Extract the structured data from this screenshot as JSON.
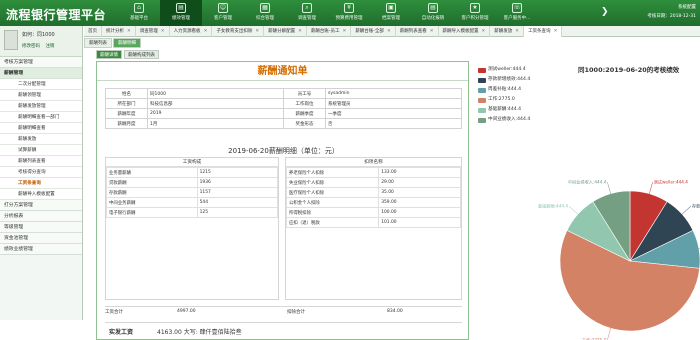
{
  "header": {
    "title": "流程银行管理平台",
    "right_line1": "系统配置",
    "right_line2": "考核日期：2018-12-31"
  },
  "modules": [
    {
      "label": "基础平台",
      "icon": "home-icon"
    },
    {
      "label": "绩效管理",
      "icon": "chart-icon"
    },
    {
      "label": "客户管理",
      "icon": "users-icon"
    },
    {
      "label": "综合管理",
      "icon": "grid-icon"
    },
    {
      "label": "调查管理",
      "icon": "search-icon"
    },
    {
      "label": "预算费用管理",
      "icon": "budget-icon"
    },
    {
      "label": "档案管理",
      "icon": "folder-icon"
    },
    {
      "label": "自动化报销",
      "icon": "document-icon"
    },
    {
      "label": "客户积分管理",
      "icon": "star-icon"
    },
    {
      "label": "客户服务中...",
      "icon": "service-icon"
    }
  ],
  "sidebar": {
    "user_name": "如何：同1000",
    "actions": [
      "修改密码",
      "注销"
    ],
    "groups": [
      {
        "label": "考核方案管理",
        "open": false
      },
      {
        "label": "薪酬管理",
        "open": true
      }
    ],
    "items": [
      "二次分配管理",
      "薪酬领管理",
      "薪酬发放管理",
      "薪酬明细查看一部门",
      "薪酬明细查看",
      "薪酬发放",
      "试算薪酬",
      "薪酬列表查看",
      "考核得分查询",
      "工资条查询",
      "薪酬导入模板配置"
    ],
    "active_item": "工资条查询",
    "bottom_groups": [
      "打分方案管理",
      "分析报表",
      "等级管理",
      "资金池管理",
      "绩效业绩管理"
    ]
  },
  "tabs": [
    {
      "label": "首页"
    },
    {
      "label": "统计分析"
    },
    {
      "label": "调查管理"
    },
    {
      "label": "人力资源看板"
    },
    {
      "label": "子女教育支出扣除"
    },
    {
      "label": "薪酬分解配置"
    },
    {
      "label": "薪酬台账-员工"
    },
    {
      "label": "薪酬台账-全部"
    },
    {
      "label": "薪酬列表查看"
    },
    {
      "label": "薪酬导入模板配置"
    },
    {
      "label": "薪酬发放"
    },
    {
      "label": "工资条查询"
    }
  ],
  "subtabs": [
    "薪酬列表",
    "薪酬明细"
  ],
  "inner_tabs": [
    "薪酬详情",
    "薪酬构成列表"
  ],
  "notice": {
    "title": "薪酬通知单",
    "info_rows": [
      [
        "姓名",
        "同1000",
        "员工号",
        "sysadmin"
      ],
      [
        "所在部门",
        "科技信息部",
        "工作岗位",
        "系统管理员"
      ],
      [
        "薪酬年度",
        "2019",
        "薪酬季度",
        "一季度"
      ],
      [
        "薪酬月度",
        "1月",
        "奖金形态",
        "否"
      ]
    ],
    "detail_title": "2019-06-20薪酬明细（单位：元）",
    "left_head": "工资构成",
    "right_head": "扣项名称",
    "left_rows": [
      [
        "业务量薪酬",
        "1215"
      ],
      [
        "贷款薪酬",
        "1936"
      ],
      [
        "存款薪酬",
        "1157"
      ],
      [
        "中间业务薪酬",
        "544"
      ],
      [
        "电子银行薪酬",
        "125"
      ]
    ],
    "right_rows": [
      [
        "养老保险个人扣除",
        "133.00"
      ],
      [
        "失业保险个人扣除",
        "29.00"
      ],
      [
        "医疗保险个人扣除",
        "35.00"
      ],
      [
        "公积金个人扣除",
        "359.00"
      ],
      [
        "所得税扣除",
        "100.00"
      ],
      [
        "应扣（退）税款",
        "101.00"
      ]
    ],
    "total_left_label": "工资合计",
    "total_left_value": "4997.00",
    "total_right_label": "扣除合计",
    "total_right_value": "834.00",
    "pay_label": "实发工资",
    "pay_value": "4163.00 大写: 肆仟壹佰陆拾叁"
  },
  "chart_data": {
    "type": "pie",
    "title": "同1000:2019-06-20的考核绩效",
    "legend_position": "left",
    "slices": [
      {
        "name": "测试weller",
        "value": 444.4,
        "color": "#c23531"
      },
      {
        "name": "存款新增绩效",
        "value": 444.4,
        "color": "#2f4554"
      },
      {
        "name": "周差补贴",
        "value": 444.4,
        "color": "#61a0a8"
      },
      {
        "name": "工作",
        "value": 2775.0,
        "color": "#d48265"
      },
      {
        "name": "基础薪酬",
        "value": 444.4,
        "color": "#91c7ae"
      },
      {
        "name": "中间业绩收入",
        "value": 444.4,
        "color": "#749f83"
      }
    ]
  }
}
